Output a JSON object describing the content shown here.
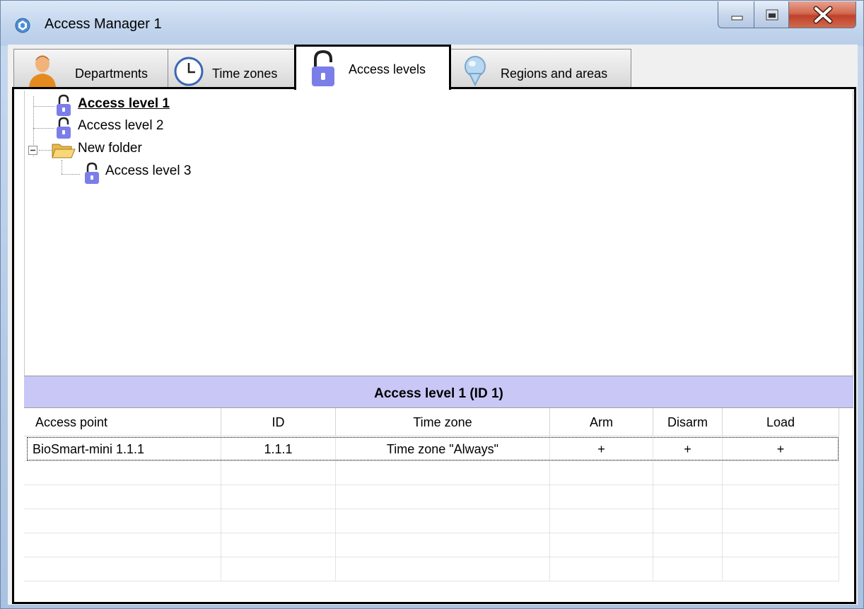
{
  "window": {
    "title": "Access Manager 1",
    "controls": [
      "minimize-icon",
      "maximize-icon",
      "close-icon"
    ]
  },
  "tabs": [
    {
      "label": "Departments",
      "icon": "person-icon",
      "active": false
    },
    {
      "label": "Time zones",
      "icon": "clock-icon",
      "active": false
    },
    {
      "label": "Access levels",
      "icon": "lock-icon",
      "active": true
    },
    {
      "label": "Regions and areas",
      "icon": "map-pin-icon",
      "active": false
    }
  ],
  "tree": {
    "items": [
      {
        "label": "Access level 1",
        "icon": "lock-icon",
        "selected": true
      },
      {
        "label": "Access level 2",
        "icon": "lock-icon",
        "selected": false
      },
      {
        "label": "New folder",
        "icon": "folder-open-icon",
        "expanded": true
      },
      {
        "label": "Access level 3",
        "icon": "lock-icon",
        "selected": false
      }
    ]
  },
  "details": {
    "title": "Access level 1 (ID 1)",
    "columns": [
      "Access point",
      "ID",
      "Time zone",
      "Arm",
      "Disarm",
      "Load"
    ],
    "rows": [
      [
        "BioSmart-mini 1.1.1",
        "1.1.1",
        "Time zone \"Always\"",
        "+",
        "+",
        "+"
      ]
    ]
  },
  "colors": {
    "details_background": "#c8c7f6",
    "lock_icon": "#7b7ee8"
  }
}
